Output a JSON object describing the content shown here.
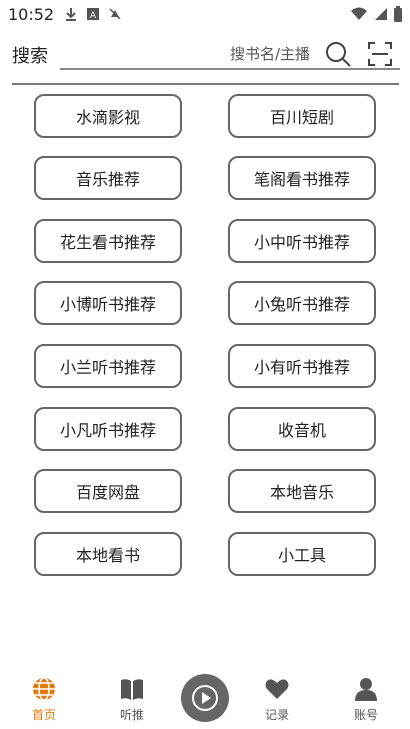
{
  "status_bar": {
    "time": "10:52"
  },
  "search": {
    "label": "搜索",
    "placeholder": "搜书名/主播"
  },
  "grid": {
    "items": [
      {
        "label": "水滴影视"
      },
      {
        "label": "百川短剧"
      },
      {
        "label": "音乐推荐"
      },
      {
        "label": "笔阁看书推荐"
      },
      {
        "label": "花生看书推荐"
      },
      {
        "label": "小中听书推荐"
      },
      {
        "label": "小博听书推荐"
      },
      {
        "label": "小兔听书推荐"
      },
      {
        "label": "小兰听书推荐"
      },
      {
        "label": "小有听书推荐"
      },
      {
        "label": "小凡听书推荐"
      },
      {
        "label": "收音机"
      },
      {
        "label": "百度网盘"
      },
      {
        "label": "本地音乐"
      },
      {
        "label": "本地看书"
      },
      {
        "label": "小工具"
      }
    ]
  },
  "bottom_nav": {
    "home": "首页",
    "recommend": "听推",
    "history": "记录",
    "account": "账号"
  },
  "colors": {
    "accent": "#e07b10",
    "border": "#666666"
  }
}
